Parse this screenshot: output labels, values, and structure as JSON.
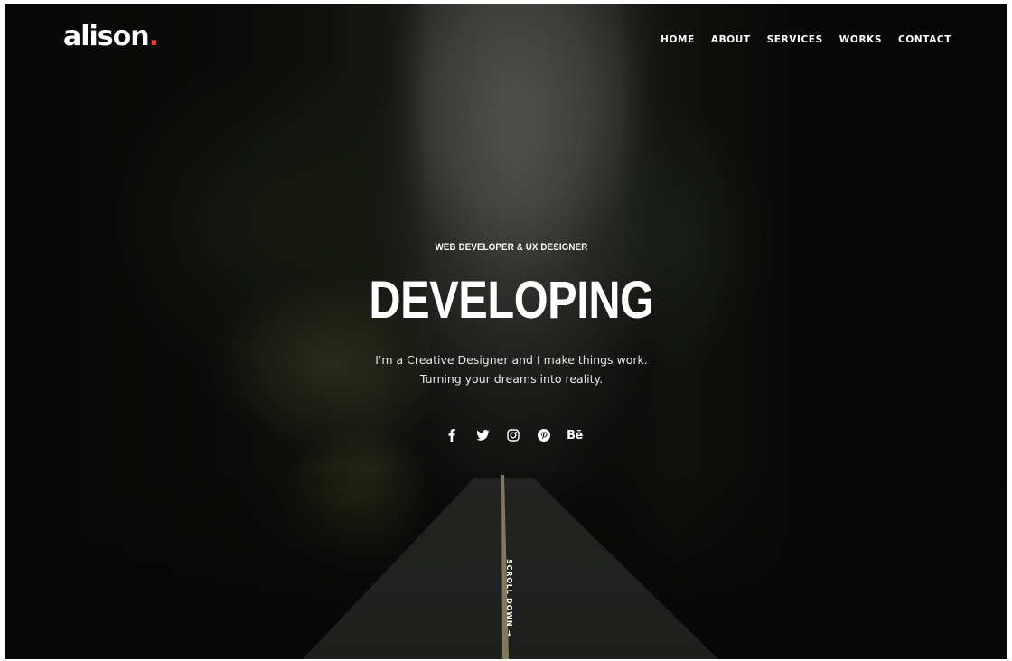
{
  "brand": {
    "name": "alison",
    "dot": ".",
    "accent_color": "#e8403b"
  },
  "nav": {
    "items": [
      {
        "label": "HOME"
      },
      {
        "label": "ABOUT"
      },
      {
        "label": "SERVICES"
      },
      {
        "label": "WORKS"
      },
      {
        "label": "CONTACT"
      }
    ]
  },
  "hero": {
    "subtitle": "WEB DEVELOPER & UX DESIGNER",
    "title": "DEVELOPING",
    "description_line1": "I'm a Creative Designer and I make things work.",
    "description_line2": "Turning your dreams into reality."
  },
  "socials": [
    {
      "icon": "facebook-icon"
    },
    {
      "icon": "twitter-icon"
    },
    {
      "icon": "instagram-icon"
    },
    {
      "icon": "pinterest-icon"
    },
    {
      "icon": "behance-icon",
      "text": "Bē"
    }
  ],
  "scroll": {
    "label": "SCROLL DOWN →"
  }
}
